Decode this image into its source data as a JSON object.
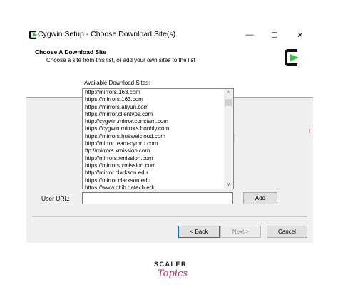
{
  "window": {
    "title": "Cygwin Setup - Choose Download Site(s)",
    "controls": {
      "minimize": "—",
      "maximize": "☐",
      "close": "✕"
    }
  },
  "header": {
    "title": "Choose A Download Site",
    "subtitle": "Choose a site from this list, or add your own sites to the list"
  },
  "sites": {
    "label": "Available Download Sites:",
    "items": [
      "http://mirrors.163.com",
      "https://mirrors.163.com",
      "https://mirrors.aliyun.com",
      "https://mirror.clientvps.com",
      "http://cygwin.mirror.constant.com",
      "https://cygwin.mirrors.hoobly.com",
      "https://mirrors.huaweicloud.com",
      "http://mirror.team-cymru.com",
      "ftp://mirrors.xmission.com",
      "http://mirrors.xmission.com",
      "https://mirrors.xmission.com",
      "http://mirror.clarkson.edu",
      "https://mirror.clarkson.edu",
      "https://www.gtlib.gatech.edu"
    ],
    "scroll_up": "^",
    "scroll_down": "v"
  },
  "user_url": {
    "label": "User URL:",
    "value": "",
    "add_label": "Add"
  },
  "footer": {
    "back_label": "< Back",
    "next_label": "Next >",
    "cancel_label": "Cancel"
  },
  "branding": {
    "line1": "SCALER",
    "line2": "Topics"
  },
  "colors": {
    "dialog_bg": "#f0f0f0",
    "accent_green": "#3cc43c",
    "focus_blue": "#0078d7",
    "brand_pink": "#c0257a"
  },
  "icons": {
    "app": "cygwin-logo-icon",
    "header_logo": "cygwin-logo-icon"
  }
}
